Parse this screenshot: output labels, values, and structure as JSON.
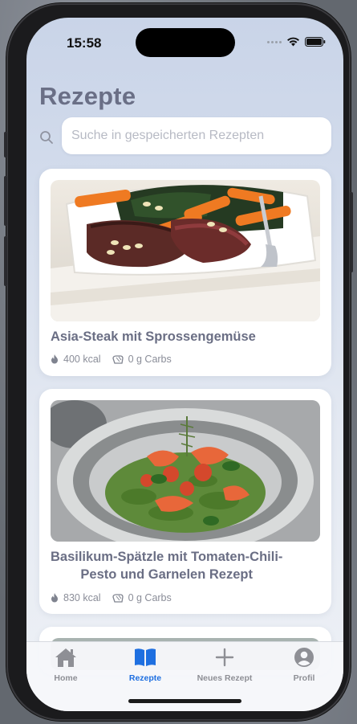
{
  "status_bar": {
    "time": "15:58"
  },
  "page": {
    "title": "Rezepte"
  },
  "search": {
    "placeholder": "Suche in gespeicherten Rezepten"
  },
  "recipes": [
    {
      "name": "Asia-Steak mit Sprossengemüse",
      "kcal": "400 kcal",
      "carbs": "0 g Carbs",
      "image": "steak-vegetables-photo"
    },
    {
      "name_line1": "Basilikum-Spätzle mit Tomaten-Chili-",
      "name_line2": "Pesto und Garnelen Rezept",
      "kcal": "830 kcal",
      "carbs": "0 g Carbs",
      "image": "spaetzle-shrimp-photo"
    }
  ],
  "tabs": [
    {
      "label": "Home",
      "icon": "house-icon",
      "active": false
    },
    {
      "label": "Rezepte",
      "icon": "book-icon",
      "active": true
    },
    {
      "label": "Neues Rezept",
      "icon": "plus-icon",
      "active": false
    },
    {
      "label": "Profil",
      "icon": "person-circle-icon",
      "active": false
    }
  ],
  "colors": {
    "accent": "#1e6fe0",
    "inactive": "#8e8f95",
    "title": "#6a6f86"
  }
}
